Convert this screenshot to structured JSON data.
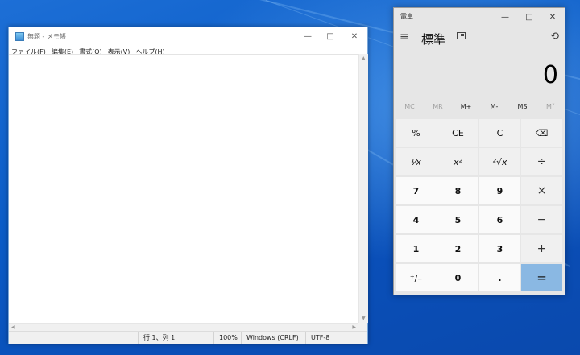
{
  "notepad": {
    "title": "無題 - メモ帳",
    "menu": [
      "ファイル(F)",
      "編集(E)",
      "書式(O)",
      "表示(V)",
      "ヘルプ(H)"
    ],
    "content": "",
    "status": {
      "position": "行 1、列 1",
      "zoom": "100%",
      "line_ending": "Windows (CRLF)",
      "encoding": "UTF-8"
    }
  },
  "calculator": {
    "title": "電卓",
    "mode": "標準",
    "display": "0",
    "memory": [
      "MC",
      "MR",
      "M+",
      "M-",
      "MS",
      "M˅"
    ],
    "memory_enabled": [
      false,
      false,
      true,
      true,
      true,
      false
    ],
    "keys": [
      [
        "%",
        "CE",
        "C",
        "⌫"
      ],
      [
        "¹⁄x",
        "x²",
        "²√x",
        "÷"
      ],
      [
        "7",
        "8",
        "9",
        "×"
      ],
      [
        "4",
        "5",
        "6",
        "−"
      ],
      [
        "1",
        "2",
        "3",
        "+"
      ],
      [
        "⁺∕₋",
        "0",
        ".",
        "="
      ]
    ]
  },
  "colors": {
    "desktop": "#0b5cc7",
    "equals_key": "#8ab8e3"
  }
}
